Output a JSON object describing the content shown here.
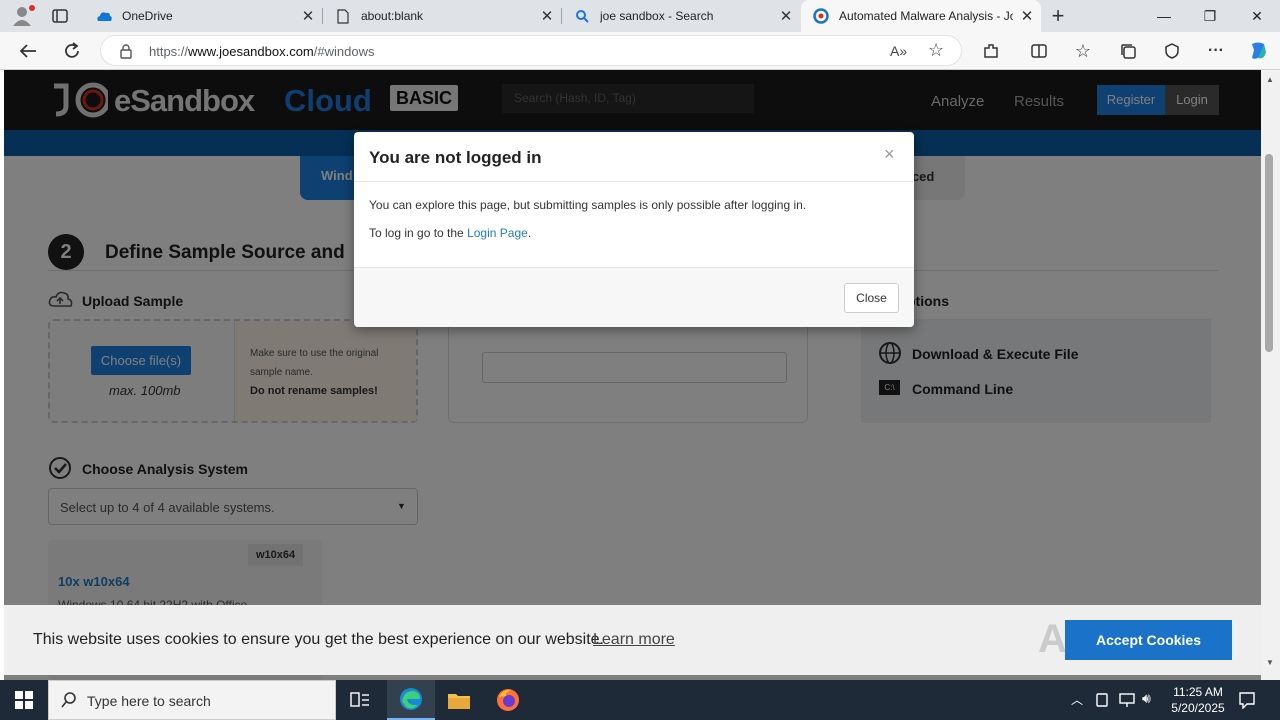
{
  "browser": {
    "tabs": [
      {
        "title": "OneDrive",
        "icon": "onedrive-icon"
      },
      {
        "title": "about:blank",
        "icon": "page-icon"
      },
      {
        "title": "joe sandbox - Search",
        "icon": "search-icon"
      },
      {
        "title": "Automated Malware Analysis - Jo",
        "icon": "joesandbox-icon",
        "active": true
      }
    ],
    "url_prefix": "https://",
    "url_domain": "www.joesandbox.com",
    "url_path": "/#windows"
  },
  "site": {
    "logo_main": "JOESandbox",
    "logo_cloud": "Cloud",
    "logo_badge": "BASIC",
    "search_placeholder": "Search (Hash, ID, Tag)",
    "nav_analyze": "Analyze",
    "nav_results": "Results",
    "register": "Register",
    "login": "Login",
    "os_tab_windows": "Wind",
    "os_tab_advanced": "nced",
    "step_number": "2",
    "step_title": "Define Sample Source and",
    "upload_title": "Upload Sample",
    "choose_files": "Choose file(s)",
    "max_size": "max. 100mb",
    "hint_line1": "Make sure to use the original",
    "hint_line2": "sample name.",
    "hint_bold": "Do not rename samples!",
    "options_title": "ptions",
    "option_download": "Download & Execute File",
    "option_cmdline": "Command Line",
    "analysis_title": "Choose Analysis System",
    "analysis_select": "Select up to 4 of 4 available systems.",
    "system_tag": "w10x64",
    "system_name": "10x w10x64",
    "system_desc": "Windows 10 64 bit 22H2 with Office"
  },
  "modal": {
    "title": "You are not logged in",
    "close_x": "×",
    "line1": "You can explore this page, but submitting samples is only possible after logging in.",
    "line2_prefix": "To log in go to the ",
    "line2_link": "Login Page",
    "line2_suffix": ".",
    "close_button": "Close"
  },
  "cookie": {
    "message": "This website uses cookies to ensure you get the best experience on our website.",
    "learn_more": "Learn more",
    "accept": "Accept Cookies"
  },
  "watermark": "ANY.RUN",
  "taskbar": {
    "search_placeholder": "Type here to search",
    "time": "11:25 AM",
    "date": "5/20/2025"
  },
  "colors": {
    "site_header": "#1a1a1a",
    "site_bar": "#0a5ea8",
    "link": "#1d7cc4",
    "accept_button": "#1a73c8"
  }
}
